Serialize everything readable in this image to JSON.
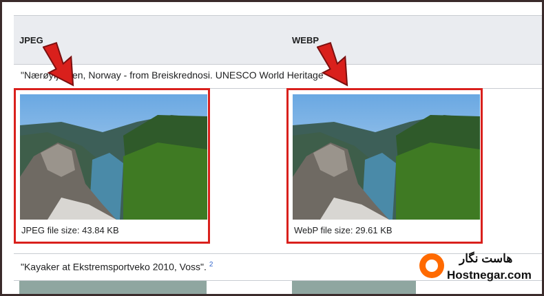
{
  "table": {
    "headers": [
      "JPEG",
      "WEBP"
    ],
    "rows": [
      {
        "caption": "\"Nærøyfjorden, Norway - from Breiskrednosi. UNESCO World Heritage\"",
        "jpeg_size_label": "JPEG file size: 43.84 KB",
        "webp_size_label": "WebP file size: 29.61 KB"
      },
      {
        "caption": "\"Kayaker at Ekstremsportveko 2010, Voss\".",
        "footnote": "2"
      }
    ]
  },
  "logo": {
    "name_fa": "هاست نگار",
    "name_en": "Hostnegar.com"
  },
  "colors": {
    "highlight": "#d9201c",
    "arrow": "#d9201c",
    "header_bg": "#eaecf0",
    "link": "#3366cc",
    "brand": "#ff6a00"
  },
  "icons": [
    "red-arrow-icon",
    "hostnegar-logo-icon"
  ]
}
